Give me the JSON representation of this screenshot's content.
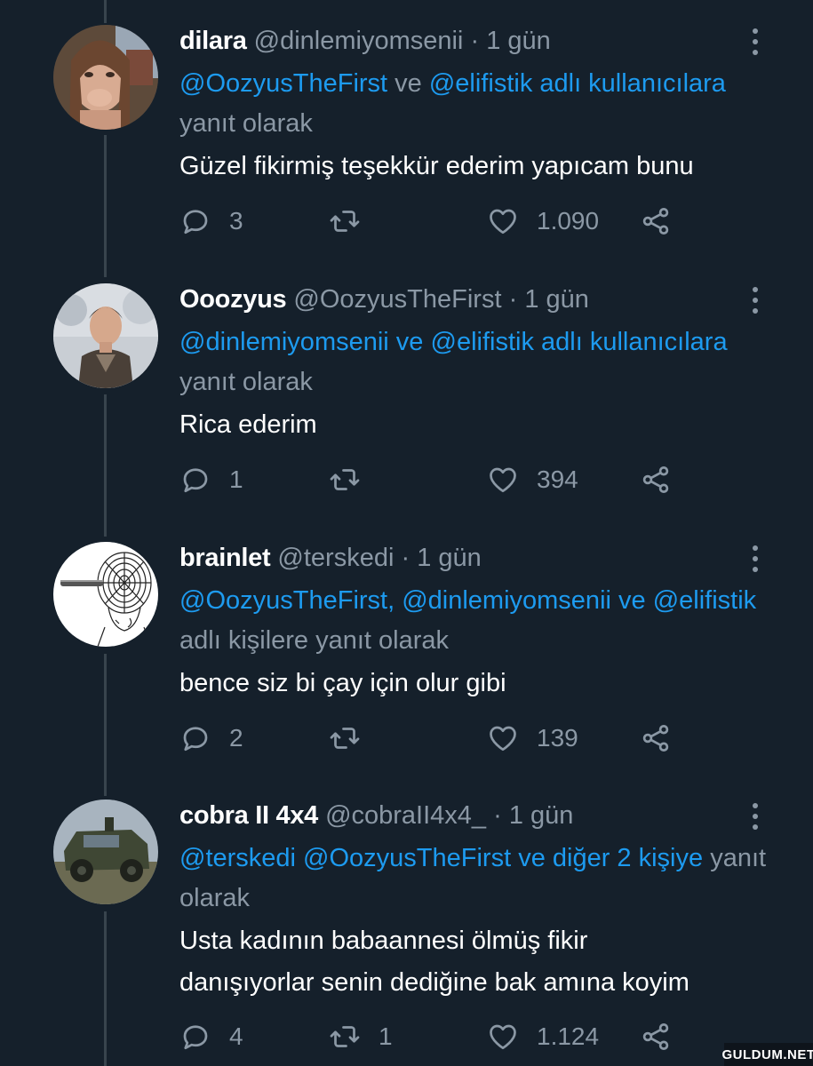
{
  "tweets": [
    {
      "name": "dilara",
      "handle": "@dinlemiyomsenii",
      "dot": "·",
      "time": "1 gün",
      "reply_parts": {
        "m1": "@OozyusTheFirst",
        "t1": " ve ",
        "m2": "@elifistik",
        "m3": " adlı kullanıcılara",
        "t2": " yanıt olarak"
      },
      "text_lines": [
        "Güzel fikirmiş teşekkür ederim yapıcam bunu"
      ],
      "stats": {
        "replies": "3",
        "retweets": "",
        "likes": "1.090"
      }
    },
    {
      "name": "Ooozyus",
      "handle": "@OozyusTheFirst",
      "dot": "·",
      "time": "1 gün",
      "reply_parts": {
        "m1": "@dinlemiyomsenii",
        "t1": " ve ",
        "m2": "@elifistik",
        "m3": " adlı kullanıcılara",
        "t2": " yanıt olarak"
      },
      "text_lines": [
        "Rica ederim"
      ],
      "stats": {
        "replies": "1",
        "retweets": "",
        "likes": "394"
      }
    },
    {
      "name": "brainlet",
      "handle": "@terskedi",
      "dot": "·",
      "time": "1 gün",
      "reply_parts": {
        "m1": "@OozyusTheFirst, @dinlemiyomsenii",
        "t1": " ",
        "m2": "ve",
        "m3": " @elifistik",
        "t2": " adlı kişilere yanıt olarak"
      },
      "text_lines": [
        "bence siz bi çay için olur gibi"
      ],
      "stats": {
        "replies": "2",
        "retweets": "",
        "likes": "139"
      }
    },
    {
      "name": "cobra II 4x4",
      "handle": "@cobraII4x4_",
      "dot": "·",
      "time": "1 gün",
      "reply_parts": {
        "m1": "@terskedi @OozyusTheFirst",
        "t1": " ",
        "m2": "ve diğer 2 kişiye",
        "m3": "",
        "t2": " yanıt olarak"
      },
      "text_lines": [
        "Usta kadının babaannesi ölmüş fikir",
        "danışıyorlar senin dediğine bak amına koyim"
      ],
      "stats": {
        "replies": "4",
        "retweets": "1",
        "likes": "1.124"
      }
    }
  ],
  "watermark": "GULDUM.NET",
  "colors": {
    "background": "#15202b",
    "mention": "#1d9bf0",
    "secondary_text": "#8b98a5",
    "thread_line": "#38444d"
  },
  "icons": [
    "reply-icon",
    "retweet-icon",
    "like-icon",
    "share-icon",
    "more-icon"
  ]
}
